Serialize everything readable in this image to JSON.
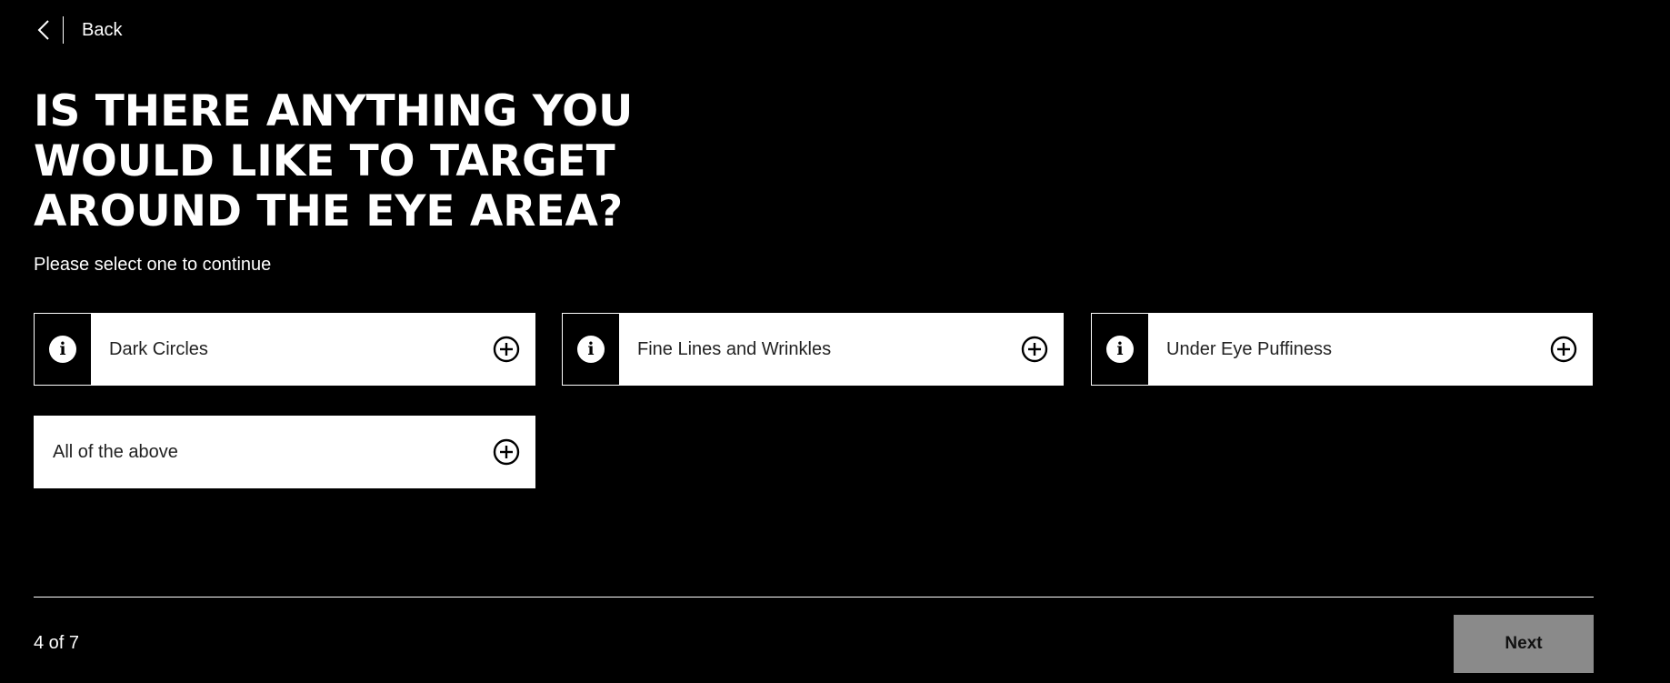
{
  "nav": {
    "back_label": "Back"
  },
  "question": {
    "title": "Is there anything you would like to target around the eye area?",
    "subtitle": "Please select one to continue"
  },
  "options": [
    {
      "label": "Dark Circles",
      "has_info": true
    },
    {
      "label": "Fine Lines and Wrinkles",
      "has_info": true
    },
    {
      "label": "Under Eye Puffiness",
      "has_info": true
    },
    {
      "label": "All of the above",
      "has_info": false
    }
  ],
  "icons": {
    "info": "info-icon",
    "add": "plus-circle-icon",
    "back": "chevron-left-icon"
  },
  "footer": {
    "progress": "4 of 7",
    "progress_current": 4,
    "progress_total": 7,
    "next_label": "Next"
  },
  "colors": {
    "background": "#000000",
    "card": "#ffffff",
    "next_button_disabled": "#8a8a8a"
  }
}
